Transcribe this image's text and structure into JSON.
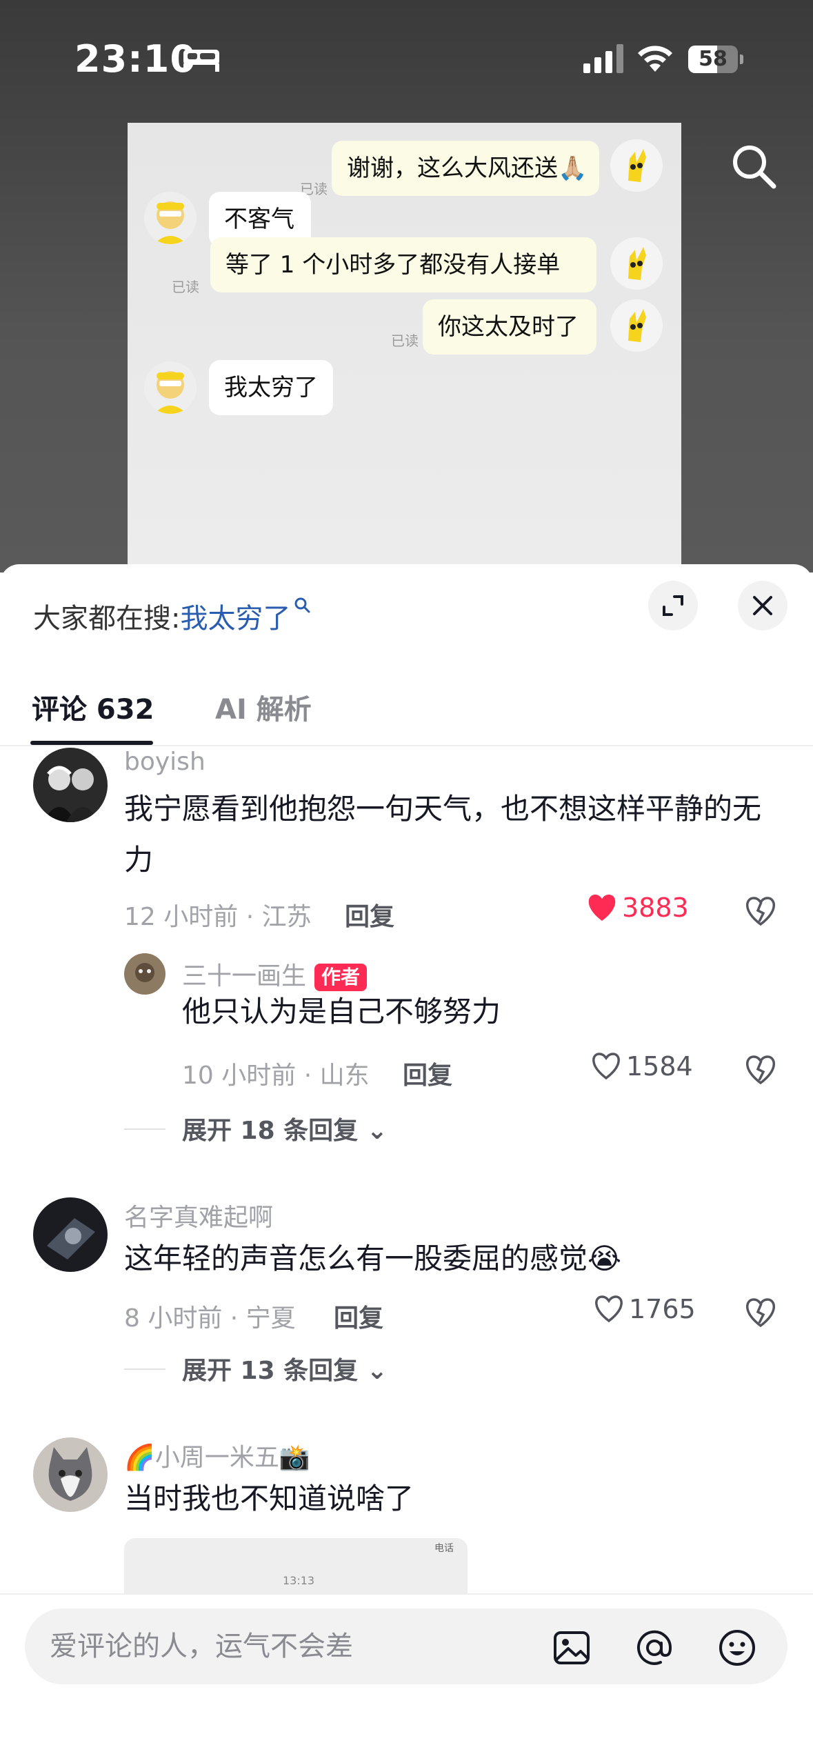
{
  "status_bar": {
    "time": "23:10",
    "battery": "58",
    "battery_level": 0.58
  },
  "video": {
    "messages": [
      {
        "side": "right",
        "text": "谢谢，这么大风还送🙏🏼",
        "read": "已读"
      },
      {
        "side": "left",
        "text": "不客气"
      },
      {
        "side": "right",
        "text": "等了 1 个小时多了都没有人接单",
        "read": "已读"
      },
      {
        "side": "right",
        "text": "你这太及时了",
        "read": "已读"
      },
      {
        "side": "left",
        "text": "我太穷了"
      }
    ]
  },
  "search_hint": {
    "prefix": "大家都在搜:",
    "keyword": "我太穷了"
  },
  "tabs": {
    "comments": "评论 632",
    "ai": "AI 解析"
  },
  "comments": [
    {
      "user": "boyish",
      "text": "我宁愿看到他抱怨一句天气，也不想这样平静的无力",
      "meta": "12 小时前 · 江苏",
      "reply": "回复",
      "likes": "3883",
      "liked": true,
      "replies": [
        {
          "user": "三十一画生",
          "badge": "作者",
          "text": "他只认为是自己不够努力",
          "meta": "10 小时前 · 山东",
          "reply": "回复",
          "likes": "1584"
        }
      ],
      "expand": "展开 18 条回复"
    },
    {
      "user": "名字真难起啊",
      "text": "这年轻的声音怎么有一股委屈的感觉😭",
      "meta": "8 小时前 · 宁夏",
      "reply": "回复",
      "likes": "1765",
      "expand": "展开 13 条回复"
    },
    {
      "user": "🌈小周一米五📸",
      "text": "当时我也不知道说啥了",
      "image_preview": {
        "label1": "电话",
        "label2": "13:13"
      }
    }
  ],
  "input": {
    "placeholder": "爱评论的人，运气不会差"
  }
}
